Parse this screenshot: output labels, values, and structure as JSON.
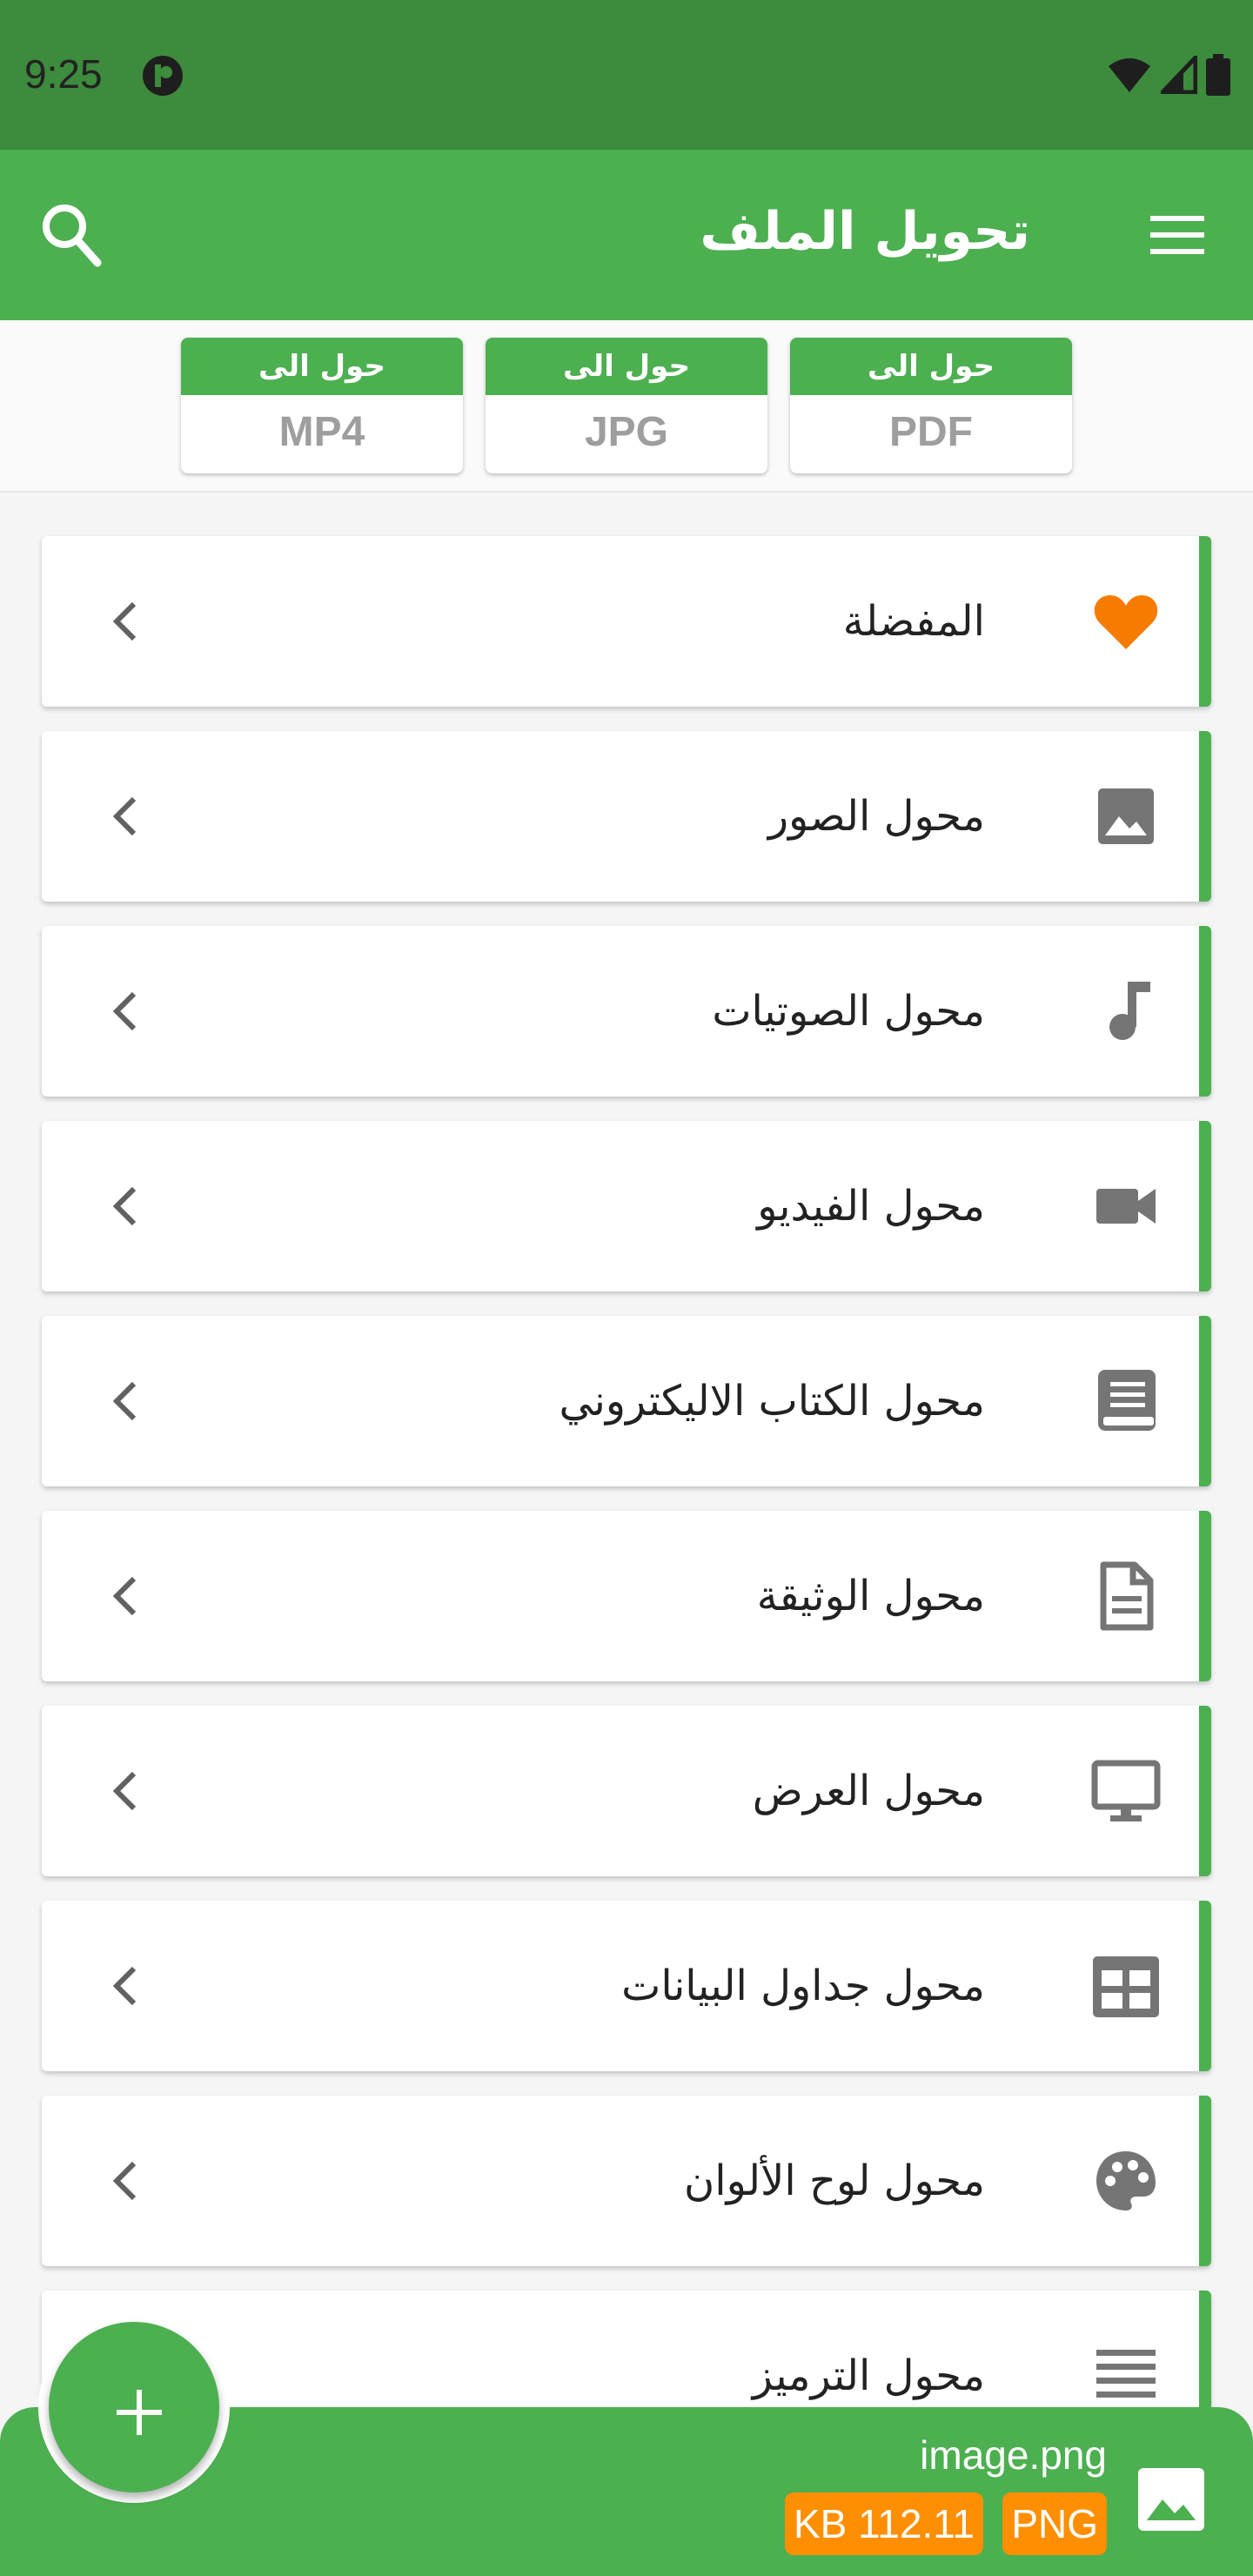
{
  "status_bar": {
    "time": "9:25"
  },
  "app_bar": {
    "title": "تحويل الملف"
  },
  "quick_convert": [
    {
      "top_label": "حول الى",
      "format": "MP4"
    },
    {
      "top_label": "حول الى",
      "format": "JPG"
    },
    {
      "top_label": "حول الى",
      "format": "PDF"
    }
  ],
  "categories": [
    {
      "label": "المفضلة",
      "icon": "heart-icon",
      "icon_color": "#f57c00"
    },
    {
      "label": "محول الصور",
      "icon": "image-icon",
      "icon_color": "#757575"
    },
    {
      "label": "محول الصوتيات",
      "icon": "music-note-icon",
      "icon_color": "#757575"
    },
    {
      "label": "محول الفيديو",
      "icon": "video-camera-icon",
      "icon_color": "#757575"
    },
    {
      "label": "محول الكتاب الاليكتروني",
      "icon": "book-icon",
      "icon_color": "#757575"
    },
    {
      "label": "محول الوثيقة",
      "icon": "document-icon",
      "icon_color": "#757575"
    },
    {
      "label": "محول العرض",
      "icon": "monitor-icon",
      "icon_color": "#757575"
    },
    {
      "label": "محول جداول البيانات",
      "icon": "table-icon",
      "icon_color": "#757575"
    },
    {
      "label": "محول لوح الألوان",
      "icon": "palette-icon",
      "icon_color": "#757575"
    },
    {
      "label": "محول الترميز",
      "icon": "lines-icon",
      "icon_color": "#757575"
    }
  ],
  "bottom_file": {
    "file_name": "image.png",
    "size": "KB 112.11",
    "type": "PNG"
  },
  "colors": {
    "primary": "#4caf50",
    "status_bar": "#3d8b3d",
    "accent": "#ff8f00"
  }
}
